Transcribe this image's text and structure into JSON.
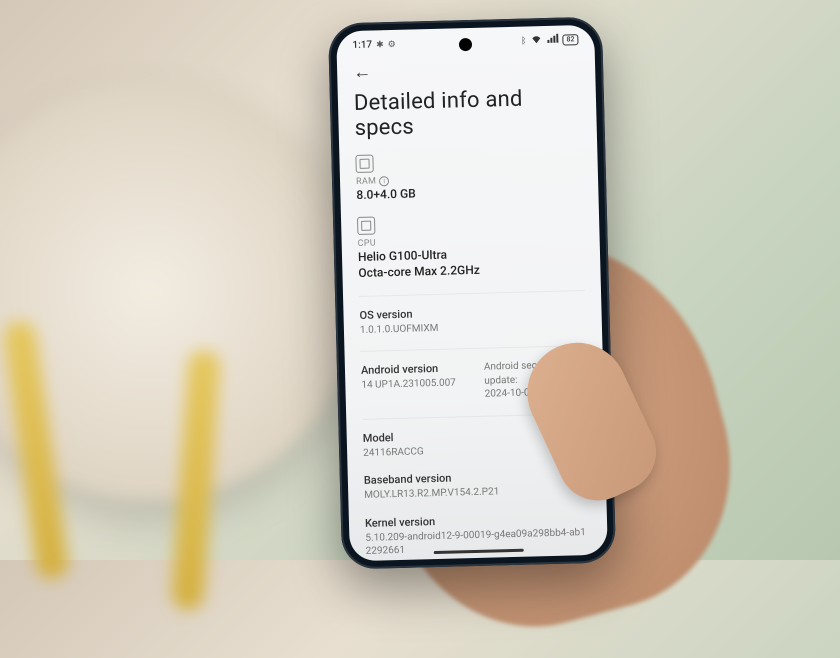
{
  "status_bar": {
    "time": "1:17",
    "battery_pct": "82"
  },
  "header": {
    "title": "Detailed info and specs"
  },
  "specs": {
    "ram": {
      "label": "RAM",
      "value": "8.0+4.0 GB"
    },
    "cpu": {
      "label": "CPU",
      "line1": "Helio G100-Ultra",
      "line2": "Octa-core Max 2.2GHz"
    },
    "os": {
      "label": "OS version",
      "value": "1.0.1.0.UOFMIXM"
    },
    "android": {
      "label": "Android version",
      "value": "14 UP1A.231005.007",
      "security_label": "Android security update:",
      "security_date": "2024-10-01"
    },
    "model": {
      "label": "Model",
      "value": "24116RACCG"
    },
    "baseband": {
      "label": "Baseband version",
      "value": "MOLY.LR13.R2.MP.V154.2.P21"
    },
    "kernel": {
      "label": "Kernel version",
      "value": "5.10.209-android12-9-00019-g4ea09a298bb4-ab12292661"
    }
  }
}
